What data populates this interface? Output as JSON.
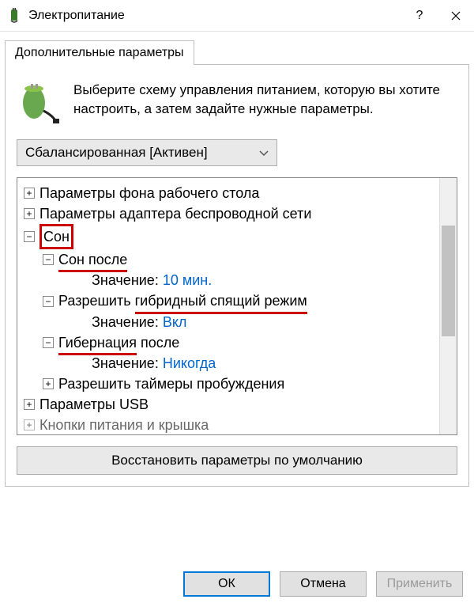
{
  "title": "Электропитание",
  "tab": "Дополнительные параметры",
  "intro": "Выберите схему управления питанием, которую вы хотите настроить, а затем задайте нужные параметры.",
  "plan": "Сбалансированная [Активен]",
  "tree": {
    "desktop_bg": "Параметры фона рабочего стола",
    "wireless": "Параметры адаптера беспроводной сети",
    "sleep": "Сон",
    "sleep_after": "Сон после",
    "value_label": "Значение:",
    "sleep_after_val": "10 мин.",
    "hybrid": "Разрешить гибридный спящий режим",
    "hybrid_val": "Вкл",
    "hibernate": "Гибернация после",
    "hibernate_val": "Никогда",
    "wake_timers": "Разрешить таймеры пробуждения",
    "usb": "Параметры USB",
    "lid": "Кнопки питания и крышка"
  },
  "restore": "Восстановить параметры по умолчанию",
  "buttons": {
    "ok": "ОК",
    "cancel": "Отмена",
    "apply": "Применить"
  }
}
